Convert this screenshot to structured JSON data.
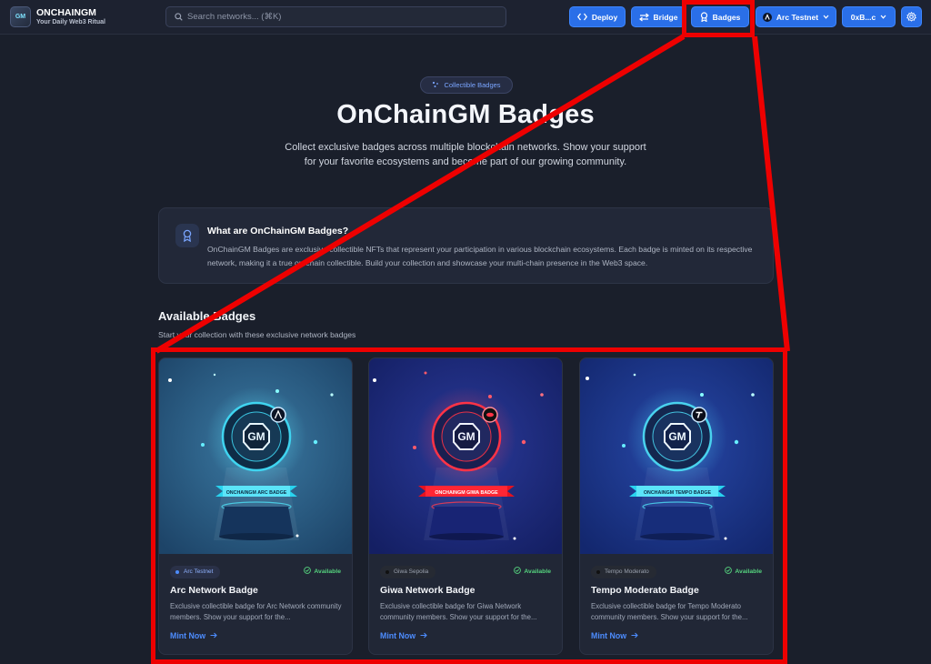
{
  "header": {
    "brand_name": "ONCHAINGM",
    "brand_tagline": "Your Daily Web3 Ritual",
    "logo_text": "GM",
    "search_placeholder": "Search networks... (⌘K)",
    "buttons": {
      "deploy": "Deploy",
      "bridge": "Bridge",
      "badges": "Badges",
      "network": "Arc Testnet",
      "wallet": "0xB...c"
    }
  },
  "hero": {
    "pill": "Collectible Badges",
    "title": "OnChainGM Badges",
    "subtitle": "Collect exclusive badges across multiple blockchain networks. Show your support for your favorite ecosystems and become part of our growing community."
  },
  "info": {
    "title": "What are OnChainGM Badges?",
    "body": "OnChainGM Badges are exclusive collectible NFTs that represent your participation in various blockchain ecosystems. Each badge is minted on its respective network, making it a true on-chain collectible. Build your collection and showcase your multi-chain presence in the Web3 space."
  },
  "section": {
    "title": "Available Badges",
    "subtitle": "Start your collection with these exclusive network badges"
  },
  "cards": [
    {
      "network": "Arc Testnet",
      "status": "Available",
      "title": "Arc Network Badge",
      "description": "Exclusive collectible badge for Arc Network community members. Show your support for the...",
      "cta": "Mint Now",
      "banner": "ONCHAINGM ARC BADGE",
      "emblem": "GM",
      "icon": "arc-logo-icon",
      "accent": "#3fd4f0",
      "dot_color": "#4d8dff"
    },
    {
      "network": "Giwa Sepolia",
      "status": "Available",
      "title": "Giwa Network Badge",
      "description": "Exclusive collectible badge for Giwa Network community members. Show your support for the...",
      "cta": "Mint Now",
      "banner": "ONCHAINGM GIWA BADGE",
      "emblem": "GM",
      "icon": "giwa-logo-icon",
      "accent": "#ff3346",
      "dot_color": "#111111"
    },
    {
      "network": "Tempo Moderato",
      "status": "Available",
      "title": "Tempo Moderato Badge",
      "description": "Exclusive collectible badge for Tempo Moderato community members. Show your support for the...",
      "cta": "Mint Now",
      "banner": "ONCHAINGM TEMPO BADGE",
      "emblem": "GM",
      "icon": "tempo-logo-icon",
      "accent": "#49d2ee",
      "dot_color": "#111111"
    }
  ],
  "colors": {
    "primary_button": "#2a6fe8",
    "highlight_annotation": "#ee0000",
    "available_green": "#55d37e",
    "link_blue": "#4d8dff"
  }
}
